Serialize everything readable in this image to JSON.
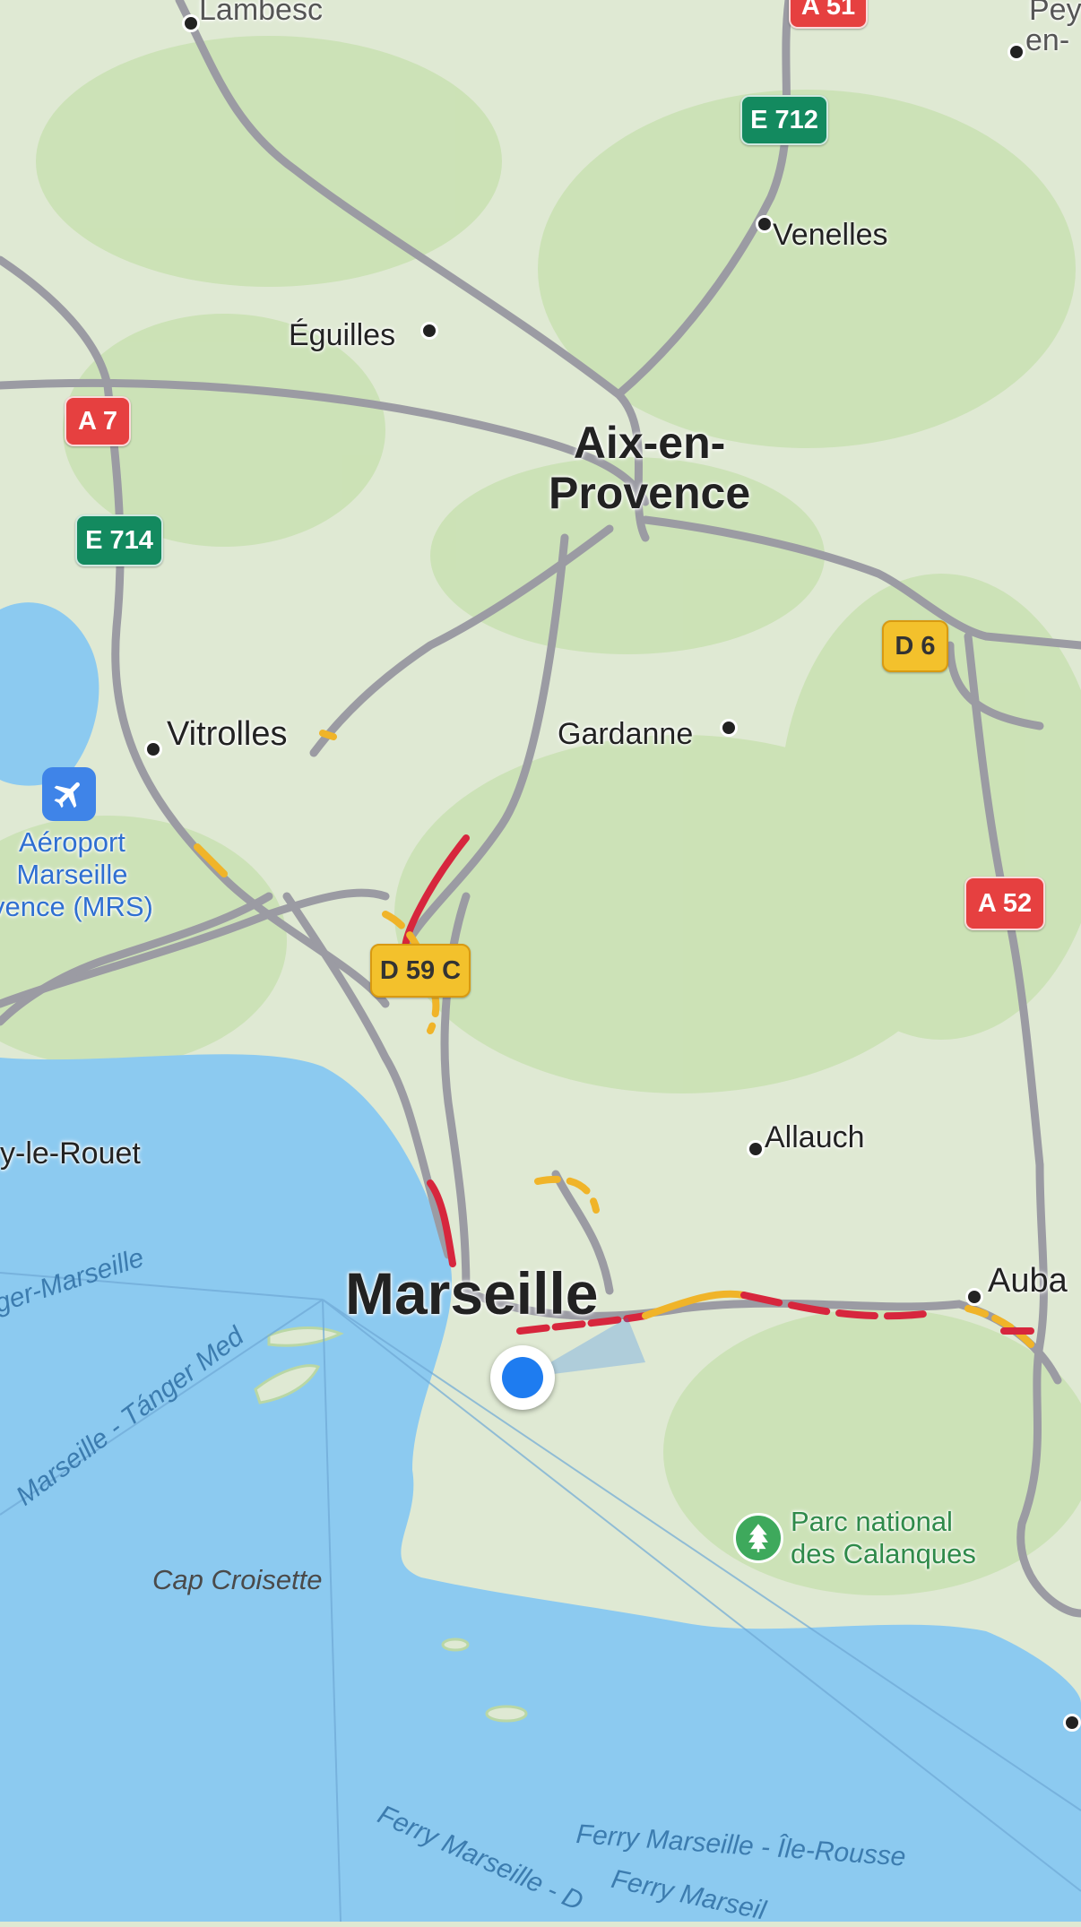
{
  "places": {
    "lambesc": "Lambesc",
    "peyrolles": "Pey-",
    "peyrolles_2": "en-",
    "venelles": "Venelles",
    "eguilles": "Éguilles",
    "aix": "Aix-en-\nProvence",
    "vitrolles": "Vitrolles",
    "gardanne": "Gardanne",
    "allauch": "Allauch",
    "marseille": "Marseille",
    "aubagne": "Auba",
    "rouet": "y-le-Rouet",
    "cap": "Cap Croisette"
  },
  "pois": {
    "airport": "Aéroport\nMarseille\nvence (MRS)",
    "park": "Parc national\ndes Calanques"
  },
  "shields": {
    "a51": "A 51",
    "e712": "E 712",
    "a7": "A 7",
    "e714": "E 714",
    "d6": "D 6",
    "a52": "A 52",
    "d59c": "D 59 C"
  },
  "sea_routes": {
    "tanger_1": "ger-Marseille",
    "tanger_2": "Marseille - Tánger Med",
    "ferry_ile_rousse": "Ferry Marseille - Île-Rousse",
    "ferry_2": "Ferry Marseille - D",
    "ferry_3": "Ferry Marseil"
  },
  "colors": {
    "land": "#dfe9d3",
    "sea": "#8ccaf0",
    "road": "#9b9ba3",
    "traffic_heavy": "#d7263d",
    "traffic_moderate": "#f0b429",
    "user_location": "#1e7cf0"
  }
}
